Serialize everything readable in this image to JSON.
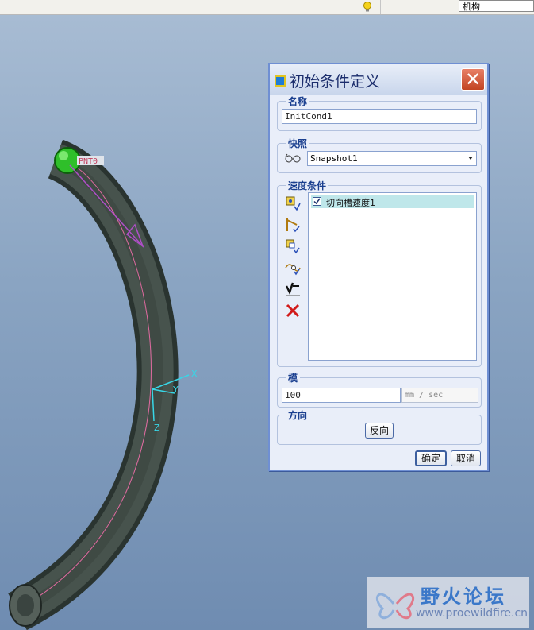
{
  "toolbar": {
    "mode_value": "机构"
  },
  "model": {
    "point_label": "PNT0",
    "axis_x": "X",
    "axis_y": "Y",
    "axis_z": "Z"
  },
  "dialog": {
    "title": "初始条件定义",
    "name_group": {
      "label": "名称",
      "value": "InitCond1"
    },
    "snapshot_group": {
      "label": "快照",
      "selected": "Snapshot1"
    },
    "velocity_group": {
      "label": "速度条件",
      "tools": [
        "point-velocity-icon",
        "joint-velocity-icon",
        "rotational-velocity-icon",
        "slot-velocity-icon",
        "tangent-slot-velocity-icon",
        "delete-icon"
      ],
      "items": [
        {
          "label": "切向槽速度1",
          "checked": true
        }
      ]
    },
    "magnitude_group": {
      "label": "模",
      "value": "100",
      "unit": "mm / sec"
    },
    "direction_group": {
      "label": "方向",
      "reverse_button": "反向"
    },
    "ok_button": "确定",
    "cancel_button": "取消"
  },
  "watermark": {
    "title": "野火论坛",
    "url": "www.proewildfire.cn"
  },
  "colors": {
    "dialog_border": "#6f8fd3",
    "title_text": "#1b2d6c",
    "group_label": "#1a3f8f",
    "list_highlight": "#bfe7ea"
  }
}
